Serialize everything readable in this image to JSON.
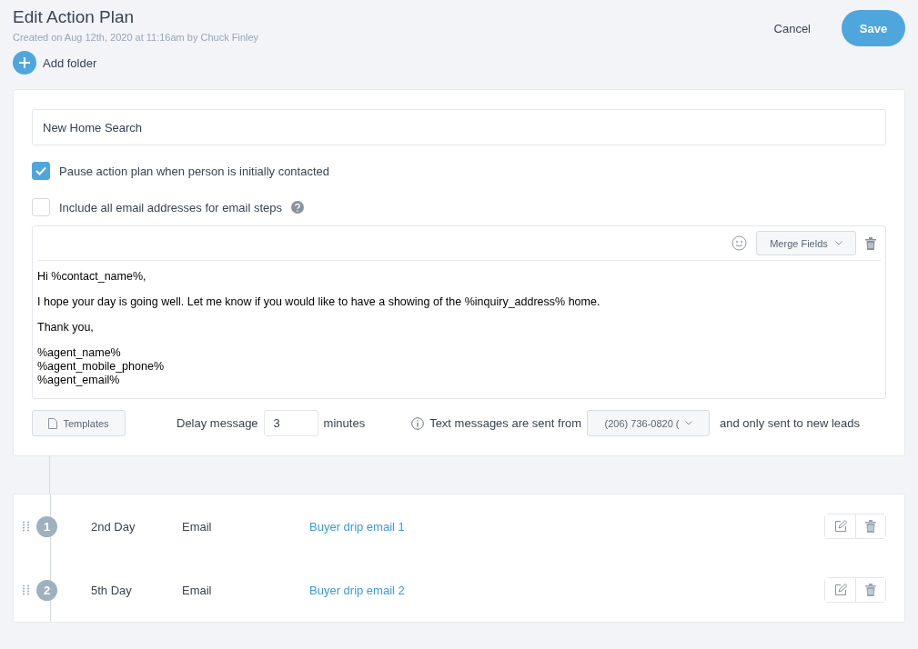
{
  "header": {
    "title": "Edit Action Plan",
    "subtitle": "Created on Aug 12th, 2020 at 11:16am by Chuck Finley",
    "add_folder": "Add folder",
    "cancel": "Cancel",
    "save": "Save"
  },
  "plan": {
    "name": "New Home Search",
    "options": [
      {
        "label": "Pause action plan when person is initially contacted",
        "checked": true,
        "help": false
      },
      {
        "label": "Include all email addresses for email steps",
        "checked": false,
        "help": true
      }
    ],
    "editor": {
      "merge_fields": "Merge Fields",
      "paragraphs": [
        [
          "Hi %contact_name%,"
        ],
        [
          "I hope your day is going well. Let me know if you would like to have a showing of the %inquiry_address% home."
        ],
        [
          "Thank you,"
        ],
        [
          "%agent_name%",
          "%agent_mobile_phone%",
          "%agent_email%"
        ]
      ]
    },
    "footer": {
      "templates": "Templates",
      "delay_label": "Delay message",
      "delay_value": "3",
      "delay_unit": "minutes",
      "sent_from_label": "Text messages are sent from",
      "phone": "(206) 736-0820 (",
      "sent_note": "and only sent to new leads"
    }
  },
  "steps": [
    {
      "number": "1",
      "day": "2nd Day",
      "type": "Email",
      "title": "Buyer drip email 1"
    },
    {
      "number": "2",
      "day": "5th Day",
      "type": "Email",
      "title": "Buyer drip email 2"
    }
  ]
}
